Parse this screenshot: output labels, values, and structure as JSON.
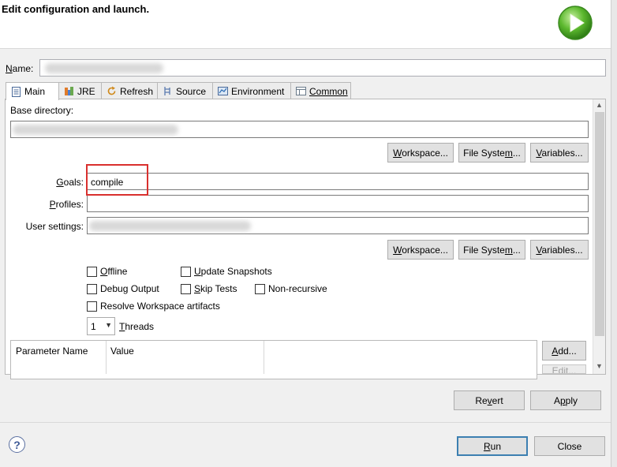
{
  "banner": {
    "title": "Edit configuration and launch."
  },
  "name": {
    "label": "Name:",
    "value": ""
  },
  "tabs": [
    {
      "label": "Main",
      "icon": "main-tab-icon"
    },
    {
      "label": "JRE",
      "icon": "jre-icon"
    },
    {
      "label": "Refresh",
      "icon": "refresh-icon"
    },
    {
      "label": "Source",
      "icon": "source-icon"
    },
    {
      "label": "Environment",
      "icon": "environment-icon"
    },
    {
      "label": "Common",
      "icon": "common-icon"
    }
  ],
  "main": {
    "base_directory_label": "Base directory:",
    "goals_label": "Goals:",
    "goals_value": "compile",
    "profiles_label": "Profiles:",
    "user_settings_label": "User settings:",
    "workspace_button": "Workspace...",
    "filesystem_button": "File System...",
    "variables_button": "Variables...",
    "checks": {
      "offline": "Offline",
      "update_snapshots": "Update Snapshots",
      "debug_output": "Debug Output",
      "skip_tests": "Skip Tests",
      "non_recursive": "Non-recursive",
      "resolve_workspace": "Resolve Workspace artifacts"
    },
    "threads_value": "1",
    "threads_label": "Threads",
    "table": {
      "columns": [
        "Parameter Name",
        "Value"
      ]
    },
    "add_button": "Add...",
    "edit_button": "Edit..."
  },
  "buttons": {
    "revert": "Revert",
    "apply": "Apply",
    "run": "Run",
    "close": "Close"
  },
  "help_glyph": "?"
}
